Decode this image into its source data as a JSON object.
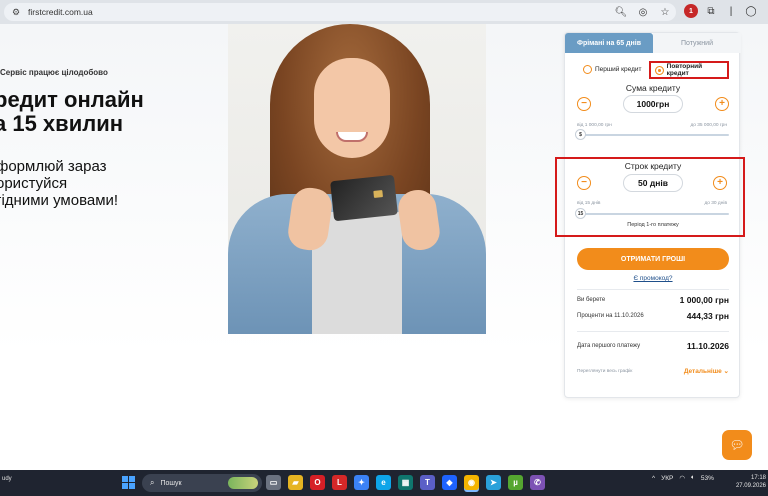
{
  "browser": {
    "url": "firstcredit.com.ua",
    "extension_badge": "1"
  },
  "hero": {
    "tagline": "Сервіс працює цілодобово",
    "title_line1": "редит онлайн",
    "title_line2": "а 15 хвилин",
    "sub_line1": "формлюй зараз",
    "sub_line2": "ористуйся",
    "sub_line3": "гідними умовами!"
  },
  "calculator": {
    "tabs": [
      {
        "label": "Фрімані на 65 днів",
        "active": true
      },
      {
        "label": "Потужний",
        "active": false
      }
    ],
    "radios": [
      {
        "label": "Перший кредит",
        "selected": false
      },
      {
        "label": "Повторний кредит",
        "selected": true
      }
    ],
    "amount": {
      "title": "Сума кредиту",
      "value": "1000грн",
      "min_label": "від 1 000,00 грн",
      "max_label": "до 35 000,00 грн",
      "knob_label": "$",
      "fill_fraction": 0.0
    },
    "term": {
      "title": "Строк кредиту",
      "value": "50 днів",
      "min_label": "від 15 днів",
      "max_label": "до 30 днів",
      "knob_label": "15",
      "period_text": "Період 1-го платежу",
      "fill_fraction": 0.0
    },
    "minus_symbol": "−",
    "plus_symbol": "+",
    "cta_label": "ОТРИМАТИ ГРОШІ",
    "promo_label": "Є промокод?",
    "summary": [
      {
        "label": "Ви берете",
        "value": "1 000,00 грн"
      },
      {
        "label": "Проценти на 11.10.2026",
        "value": "444,33 грн"
      },
      {
        "label": "Дата першого платежу",
        "value": "11.10.2026"
      }
    ],
    "schedule_label": "Переглянути весь графік",
    "details_label": "Детальніше ⌄"
  },
  "page_footer_cut": "udy",
  "taskbar": {
    "search_label": "Пошук",
    "apps": [
      {
        "name": "task-view",
        "glyph": "▭",
        "color": "#6b7280"
      },
      {
        "name": "explorer",
        "glyph": "▰",
        "color": "#e6b422"
      },
      {
        "name": "opera",
        "glyph": "O",
        "color": "#d61f26"
      },
      {
        "name": "app-l",
        "glyph": "L",
        "color": "#d62828"
      },
      {
        "name": "copilot",
        "glyph": "✦",
        "color": "#3b82f6"
      },
      {
        "name": "edge",
        "glyph": "e",
        "color": "#0ea5e9"
      },
      {
        "name": "photos",
        "glyph": "▦",
        "color": "#0f766e"
      },
      {
        "name": "teams",
        "glyph": "T",
        "color": "#5b5fc7"
      },
      {
        "name": "dropbox",
        "glyph": "◆",
        "color": "#1e63ff"
      },
      {
        "name": "chrome",
        "glyph": "◉",
        "color": "#f4b400"
      },
      {
        "name": "telegram",
        "glyph": "➤",
        "color": "#2aa1da"
      },
      {
        "name": "utorrent",
        "glyph": "µ",
        "color": "#55a630"
      },
      {
        "name": "viber",
        "glyph": "✆",
        "color": "#7d52b5"
      }
    ],
    "tray_chevron": "^",
    "language": "УКР",
    "battery": "53%",
    "time": "17:18",
    "date": "27.09.2026"
  }
}
